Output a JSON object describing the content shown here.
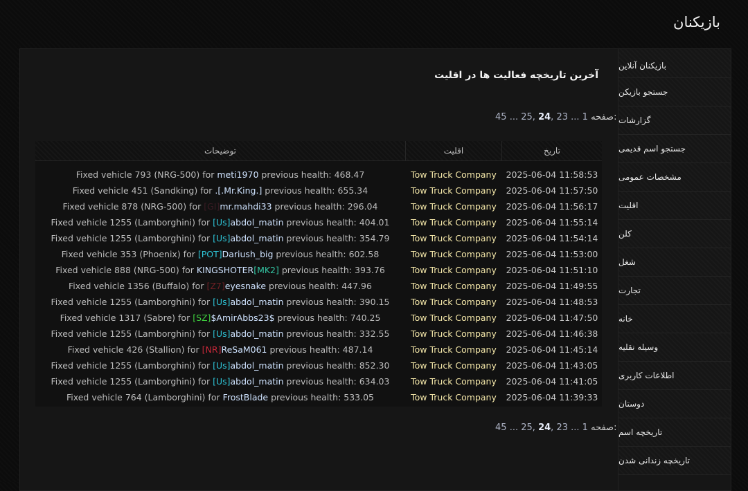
{
  "page_title": "بازیکنان",
  "sidebar": {
    "items": [
      {
        "label": "بازیکنان آنلاین"
      },
      {
        "label": "جستجو بازیکن"
      },
      {
        "label": "گزارشات"
      },
      {
        "label": "جستجو اسم قدیمی"
      },
      {
        "label": "مشخصات عمومی"
      },
      {
        "label": "اقلیت"
      },
      {
        "label": "کلن"
      },
      {
        "label": "شغل"
      },
      {
        "label": "تجارت"
      },
      {
        "label": "خانه"
      },
      {
        "label": "وسیله نقلیه"
      },
      {
        "label": "اطلاعات کاربری"
      },
      {
        "label": "دوستان"
      },
      {
        "label": "تاریخچه اسم"
      },
      {
        "label": "تاریخچه زندانی شدن"
      }
    ]
  },
  "main": {
    "title": "آخرین تاریخچه فعالیت ها در اقلیت",
    "pager": {
      "label": "صفحه:",
      "first": "1",
      "ellipsis": "...",
      "prev": "23",
      "current": "24",
      "next": "25",
      "last": "45"
    },
    "table": {
      "headers": {
        "desc": "توضیحات",
        "faction": "اقلیت",
        "date": "تاریخ"
      },
      "rows": [
        {
          "pre": "Fixed vehicle 793 (NRG-500) for ",
          "tag": "",
          "tag_color": "",
          "player": "meti1970",
          "post": " previous health: 468.47",
          "faction": "Tow Truck Company",
          "date": "2025-06-04 11:58:53"
        },
        {
          "pre": "Fixed vehicle 451 (Sandking) for ",
          "tag": "",
          "tag_color": "",
          "player": ".[.Mr.King.]",
          "post": " previous health: 655.34",
          "faction": "Tow Truck Company",
          "date": "2025-06-04 11:57:50"
        },
        {
          "pre": "Fixed vehicle 878 (NRG-500) for ",
          "tag": "[GI]",
          "tag_color": "#3a1b23",
          "player": "mr.mahdi33",
          "post": " previous health: 296.04",
          "faction": "Tow Truck Company",
          "date": "2025-06-04 11:56:17"
        },
        {
          "pre": "Fixed vehicle 1255 (Lamborghini) for ",
          "tag": "[Us]",
          "tag_color": "#2ec4d6",
          "player": "abdol_matin",
          "post": " previous health: 404.01",
          "faction": "Tow Truck Company",
          "date": "2025-06-04 11:55:14"
        },
        {
          "pre": "Fixed vehicle 1255 (Lamborghini) for ",
          "tag": "[Us]",
          "tag_color": "#2ec4d6",
          "player": "abdol_matin",
          "post": " previous health: 354.79",
          "faction": "Tow Truck Company",
          "date": "2025-06-04 11:54:14"
        },
        {
          "pre": "Fixed vehicle 353 (Phoenix) for ",
          "tag": "[POT]",
          "tag_color": "#2ec4d6",
          "player": "Dariush_big",
          "post": " previous health: 602.58",
          "faction": "Tow Truck Company",
          "date": "2025-06-04 11:53:00"
        },
        {
          "pre": "Fixed vehicle 888 (NRG-500) for ",
          "tag": "",
          "tag_color": "",
          "player": "KINGSHOTER",
          "post": " previous health: 393.76",
          "faction": "Tow Truck Company",
          "date": "2025-06-04 11:51:10",
          "suffix": "[MK2]",
          "suffix_color": "#34c6a4"
        },
        {
          "pre": "Fixed vehicle 1356 (Buffalo) for ",
          "tag": "[Z7]",
          "tag_color": "#6e1f24",
          "player": "eyesnake",
          "post": " previous health: 447.96",
          "faction": "Tow Truck Company",
          "date": "2025-06-04 11:49:55"
        },
        {
          "pre": "Fixed vehicle 1255 (Lamborghini) for ",
          "tag": "[Us]",
          "tag_color": "#2ec4d6",
          "player": "abdol_matin",
          "post": " previous health: 390.15",
          "faction": "Tow Truck Company",
          "date": "2025-06-04 11:48:53"
        },
        {
          "pre": "Fixed vehicle 1317 (Sabre) for ",
          "tag": "[SZ]",
          "tag_color": "#3fd23f",
          "player": "$AmirAbbs23$",
          "post": " previous health: 740.25",
          "faction": "Tow Truck Company",
          "date": "2025-06-04 11:47:50"
        },
        {
          "pre": "Fixed vehicle 1255 (Lamborghini) for ",
          "tag": "[Us]",
          "tag_color": "#2ec4d6",
          "player": "abdol_matin",
          "post": " previous health: 332.55",
          "faction": "Tow Truck Company",
          "date": "2025-06-04 11:46:38"
        },
        {
          "pre": "Fixed vehicle 426 (Stallion) for ",
          "tag": "[NR]",
          "tag_color": "#c8283a",
          "player": "ReSaM061",
          "post": " previous health: 487.14",
          "faction": "Tow Truck Company",
          "date": "2025-06-04 11:45:14"
        },
        {
          "pre": "Fixed vehicle 1255 (Lamborghini) for ",
          "tag": "[Us]",
          "tag_color": "#2ec4d6",
          "player": "abdol_matin",
          "post": " previous health: 852.30",
          "faction": "Tow Truck Company",
          "date": "2025-06-04 11:43:05"
        },
        {
          "pre": "Fixed vehicle 1255 (Lamborghini) for ",
          "tag": "[Us]",
          "tag_color": "#2ec4d6",
          "player": "abdol_matin",
          "post": " previous health: 634.03",
          "faction": "Tow Truck Company",
          "date": "2025-06-04 11:41:05"
        },
        {
          "pre": "Fixed vehicle 764 (Lamborghini) for ",
          "tag": "",
          "tag_color": "",
          "player": "FrostBlade",
          "post": " previous health: 533.05",
          "faction": "Tow Truck Company",
          "date": "2025-06-04 11:39:33"
        }
      ]
    }
  }
}
